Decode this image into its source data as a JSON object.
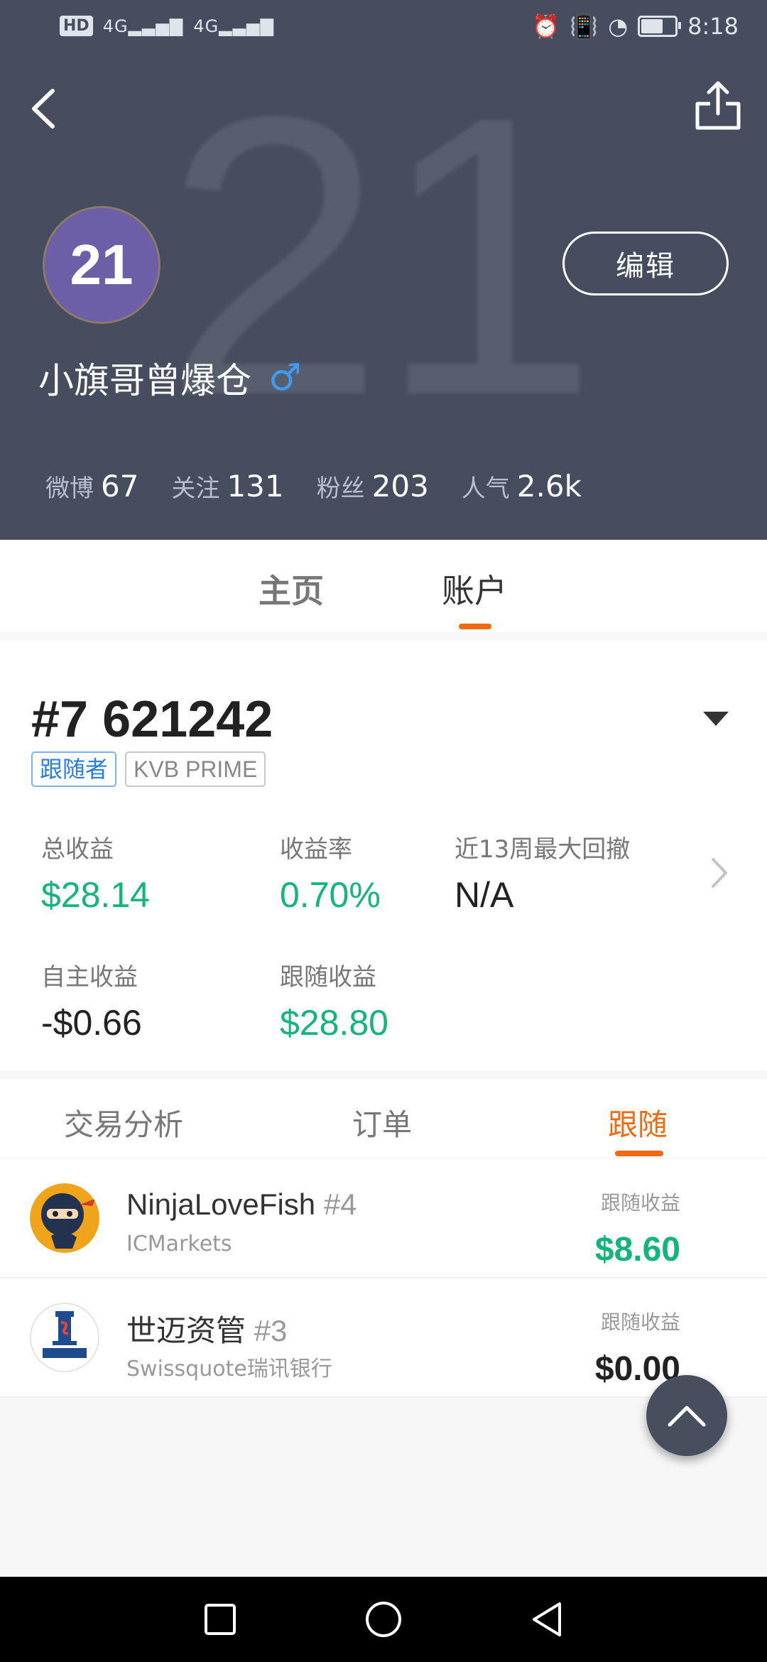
{
  "status_bar": {
    "hd_label": "HD",
    "signal_labels": [
      "4G",
      "4G"
    ],
    "time": "8:18"
  },
  "header": {
    "background_number": "21",
    "avatar_text": "21",
    "username": "小旗哥曾爆仓",
    "gender_symbol": "♂",
    "edit_label": "编辑",
    "stats": [
      {
        "label": "微博",
        "value": "67"
      },
      {
        "label": "关注",
        "value": "131"
      },
      {
        "label": "粉丝",
        "value": "203"
      },
      {
        "label": "人气",
        "value": "2.6k"
      }
    ],
    "icons": [
      "back-arrow-icon",
      "share-icon"
    ]
  },
  "main_tabs": [
    {
      "label": "主页",
      "active": false
    },
    {
      "label": "账户",
      "active": true
    }
  ],
  "account": {
    "number": "#7 621242",
    "tags": [
      "跟随者",
      "KVB PRIME"
    ],
    "metrics": {
      "total_profit": {
        "label": "总收益",
        "value": "$28.14"
      },
      "profit_rate": {
        "label": "收益率",
        "value": "0.70%"
      },
      "max_drawdown": {
        "label": "近13周最大回撤",
        "value": "N/A"
      },
      "self_profit": {
        "label": "自主收益",
        "value": "-$0.66"
      },
      "follow_profit": {
        "label": "跟随收益",
        "value": "$28.80"
      }
    }
  },
  "sub_tabs": [
    {
      "label": "交易分析",
      "active": false
    },
    {
      "label": "订单",
      "active": false
    },
    {
      "label": "跟随",
      "active": true
    }
  ],
  "follow_list": [
    {
      "name": "NinjaLoveFish",
      "rank": "#4",
      "broker": "ICMarkets",
      "profit_label": "跟随收益",
      "profit_value": "$8.60",
      "profit_color": "#13b57b"
    },
    {
      "name": "世迈资管",
      "rank": "#3",
      "broker": "Swissquote瑞讯银行",
      "profit_label": "跟随收益",
      "profit_value": "$0.00",
      "profit_color": "#222222"
    }
  ],
  "colors": {
    "header_bg": "#454d5e",
    "accent_orange": "#f06a14",
    "profit_green": "#13b57b",
    "tag_blue": "#2a7de1"
  }
}
